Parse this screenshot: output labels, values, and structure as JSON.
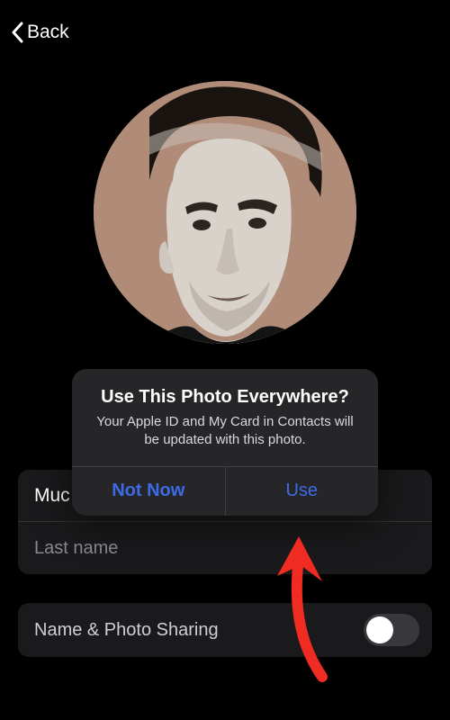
{
  "nav": {
    "back_label": "Back"
  },
  "alert": {
    "title": "Use This Photo Everywhere?",
    "message": "Your Apple ID and My Card in Contacts will be updated with this photo.",
    "not_now_label": "Not Now",
    "use_label": "Use"
  },
  "form": {
    "first_name_value": "Muc",
    "last_name_placeholder": "Last name"
  },
  "share": {
    "label": "Name & Photo Sharing",
    "enabled": false
  },
  "colors": {
    "accent": "#3d6be8",
    "avatar_bg": "#b08c78"
  }
}
